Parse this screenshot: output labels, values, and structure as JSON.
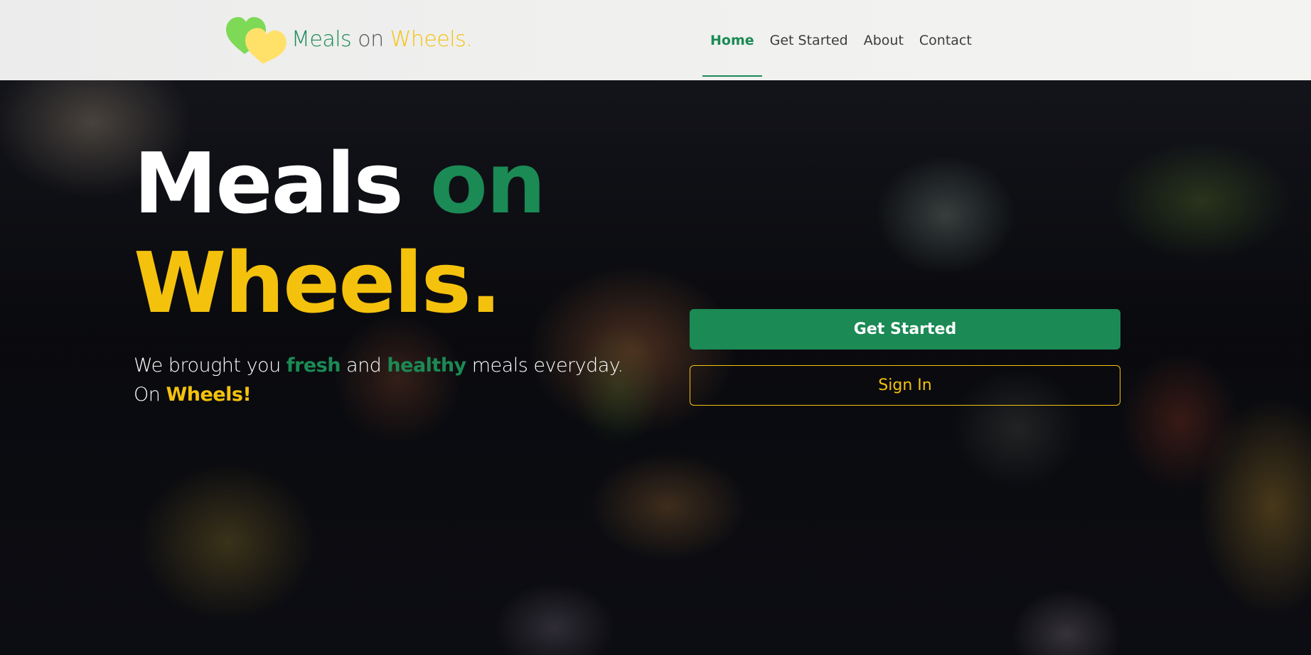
{
  "brand": {
    "part1": "Meals",
    "part2": "on",
    "part3": "Wheels",
    "part4": ".",
    "colors": {
      "green": "#1b8a55",
      "yellow": "#f4c20d",
      "light_green": "#7ed957",
      "light_yellow": "#ffe16a"
    }
  },
  "nav": {
    "items": [
      {
        "label": "Home",
        "active": true
      },
      {
        "label": "Get Started",
        "active": false
      },
      {
        "label": "About",
        "active": false
      },
      {
        "label": "Contact",
        "active": false
      }
    ]
  },
  "hero": {
    "title_word1": "Meals",
    "title_word2": "on",
    "title_word3": "Wheels.",
    "tagline_1": "We brought you ",
    "tagline_2": "fresh",
    "tagline_3": " and ",
    "tagline_4": "healthy",
    "tagline_5": " meals everyday.",
    "tagline_6": "On ",
    "tagline_7": "Wheels!",
    "primary_button": "Get Started",
    "secondary_button": "Sign In"
  }
}
